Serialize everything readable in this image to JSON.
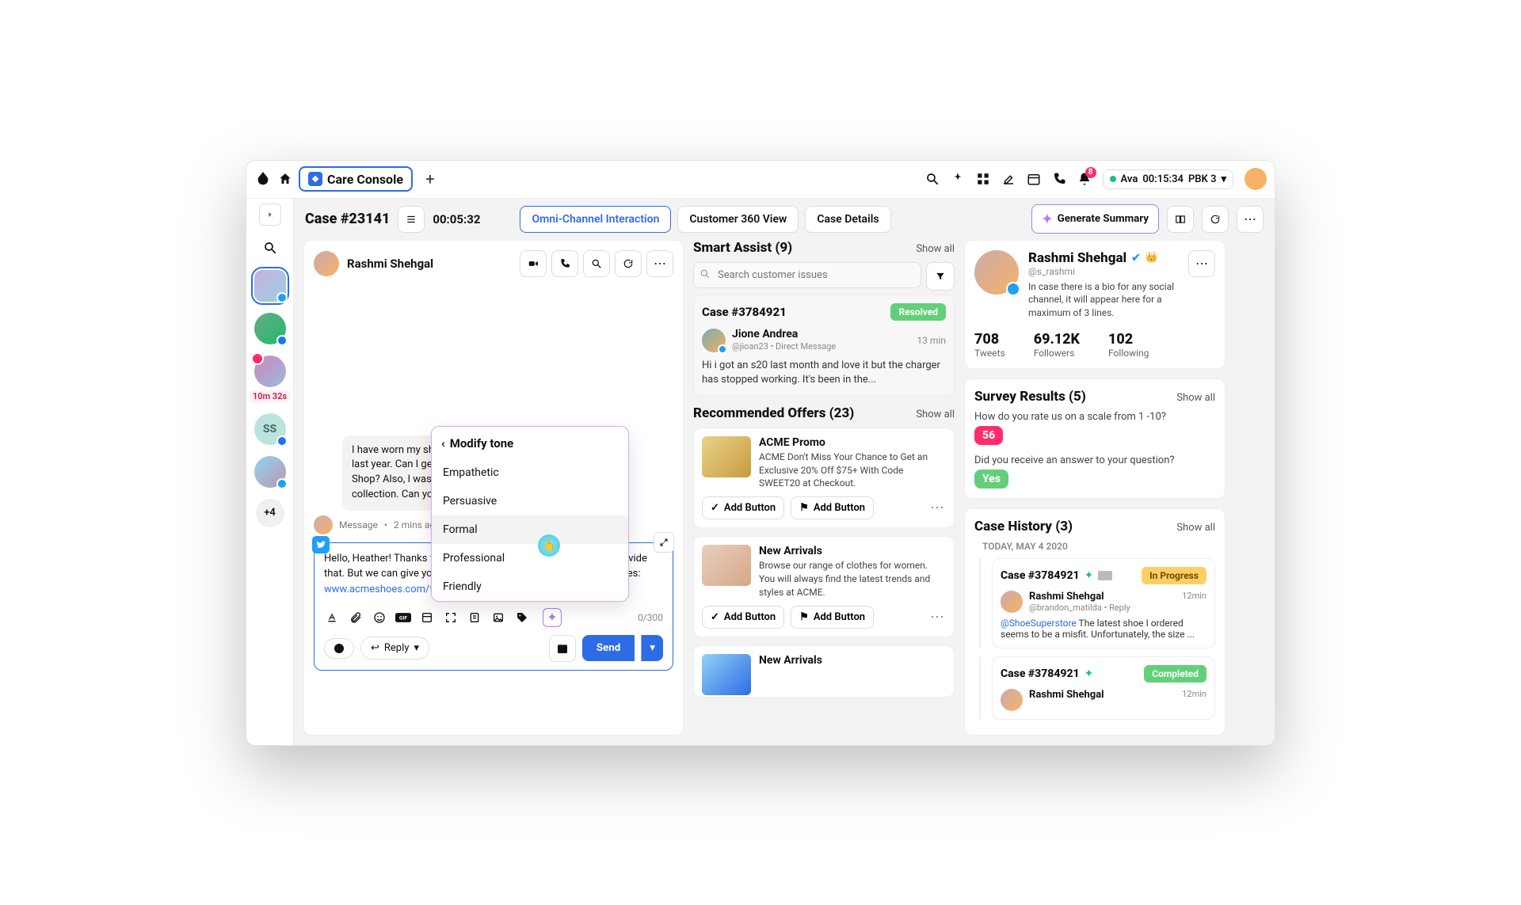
{
  "topbar": {
    "app_tab": "Care Console",
    "bell_count": "8",
    "status_name": "Ava",
    "status_timer": "00:15:34",
    "status_queue": "PBK 3"
  },
  "leftrail": {
    "timer_badge": "10m 32s",
    "ss_initials": "SS",
    "more": "+4"
  },
  "casebar": {
    "case_title": "Case #23141",
    "timer": "00:05:32",
    "tab_omni": "Omni-Channel Interaction",
    "tab_360": "Customer 360 View",
    "tab_details": "Case Details",
    "generate": "Generate Summary"
  },
  "chat": {
    "name": "Rashmi Shehgal",
    "bubble": "I have worn my shoes out with so many races last year. Can I get them repaired at an ACME Shop? Also, I was looking at the new fall shoe collection. Can you share the link?",
    "msg_meta_label": "Message",
    "msg_meta_time": "2 mins ago",
    "compose_prefix": "Hello, Heather! Thanks for reaching out. Unfortunately, we can't provide that. But we can give you a discount on a new fall collection of shoes: ",
    "compose_link": "www.acmeshoes.com/fallcollection.",
    "char_count": "0/300",
    "reply_label": "Reply",
    "send_label": "Send",
    "tone": {
      "title": "Modify tone",
      "o1": "Empathetic",
      "o2": "Persuasive",
      "o3": "Formal",
      "o4": "Professional",
      "o5": "Friendly"
    }
  },
  "assist": {
    "title": "Smart Assist (9)",
    "show_all": "Show all",
    "search_placeholder": "Search customer issues",
    "case": {
      "num": "Case #3784921",
      "status": "Resolved",
      "user": "Jione Andrea",
      "handle": "@jioan23 • Direct Message",
      "time": "13 min",
      "text": "Hi i got an s20 last month and love it but the charger has stopped working.  It's been in the..."
    },
    "rec_title": "Recommended Offers (23)",
    "rec_show_all": "Show all",
    "offer1": {
      "title": "ACME Promo",
      "desc": "ACME Don't Miss Your Chance to Get an Exclusive 20% Off $75+ With Code SWEET20 at Checkout.",
      "b1": "Add Button",
      "b2": "Add Button"
    },
    "offer2": {
      "title": "New Arrivals",
      "desc": "Browse our range of clothes for women. You will always find the latest trends and styles at ACME.",
      "b1": "Add Button",
      "b2": "Add Button"
    },
    "offer3": {
      "title": "New Arrivals"
    }
  },
  "profile": {
    "name": "Rashmi Shehgal",
    "handle": "@s_rashmi",
    "bio": "In case there is a bio for any social channel, it will appear here for a maximum of 3 lines.",
    "stat1n": "708",
    "stat1l": "Tweets",
    "stat2n": "69.12K",
    "stat2l": "Followers",
    "stat3n": "102",
    "stat3l": "Following",
    "survey_title": "Survey Results (5)",
    "survey_show_all": "Show all",
    "q1": "How do you rate us on a scale from 1 -10?",
    "a1": "56",
    "q2": "Did you receive an answer to your question?",
    "a2": "Yes",
    "hist_title": "Case History (3)",
    "hist_show_all": "Show all",
    "hist_date": "TODAY, MAY 4 2020",
    "h1": {
      "num": "Case #3784921",
      "status": "In Progress",
      "user": "Rashmi Shehgal",
      "handle": "@brandon_matilda • Reply",
      "time": "12min",
      "mention": "@ShoeSuperstore",
      "text": " The latest shoe I ordered seems to be a misfit. Unfortunately, the size ..."
    },
    "h2": {
      "num": "Case #3784921",
      "status": "Completed",
      "user": "Rashmi Shehgal",
      "time": "12min"
    }
  }
}
